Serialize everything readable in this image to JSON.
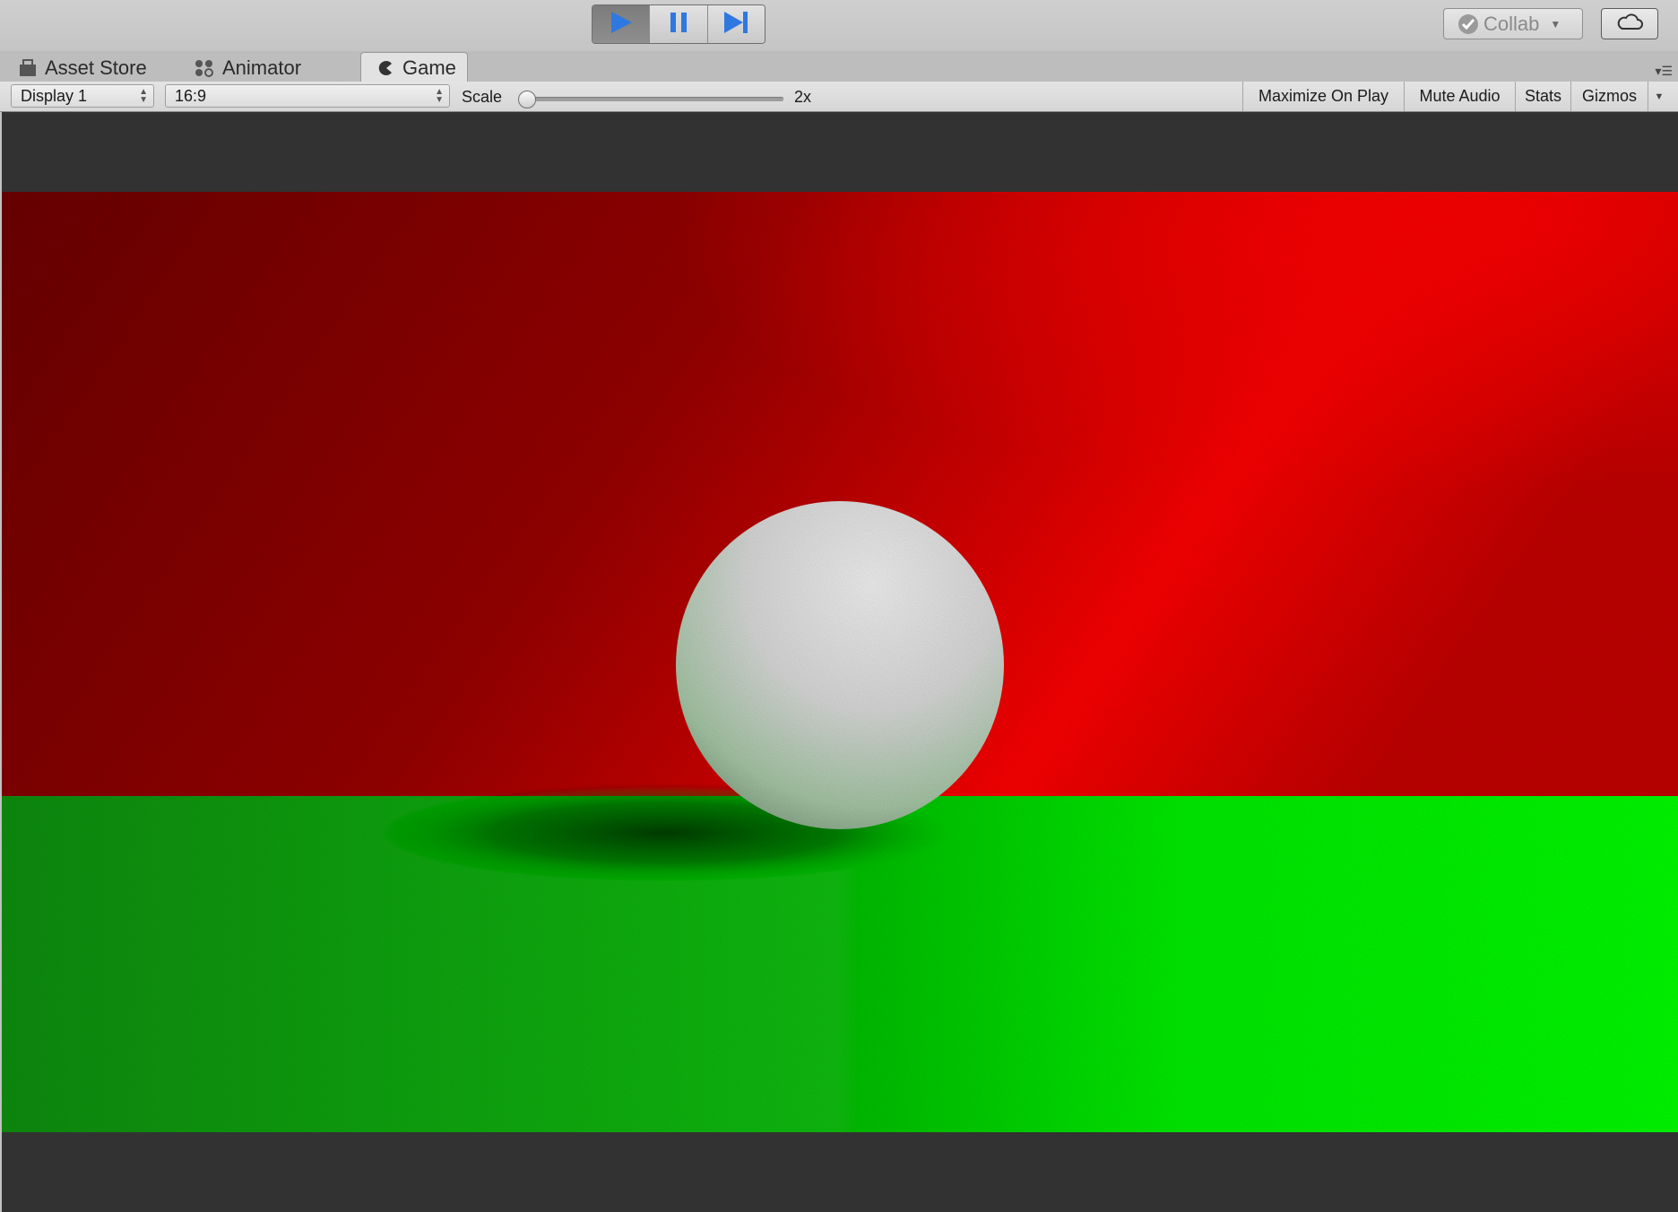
{
  "toolbar": {
    "play_state": "playing",
    "collab_label": "Collab"
  },
  "tabs": [
    {
      "label": "Asset Store",
      "icon": "asset-store-icon",
      "active": false
    },
    {
      "label": "Animator",
      "icon": "animator-icon",
      "active": false
    },
    {
      "label": "Game",
      "icon": "game-controller-icon",
      "active": true
    }
  ],
  "game_toolbar": {
    "display_select": "Display 1",
    "aspect_select": "16:9",
    "scale_label": "Scale",
    "scale_value_text": "2x",
    "scale_slider_fraction": 0.0,
    "buttons": [
      "Maximize On Play",
      "Mute Audio",
      "Stats",
      "Gizmos"
    ]
  },
  "colors": {
    "wall_red": "#ff0000",
    "wall_red_dark": "#6a0000",
    "floor_green": "#00ff00",
    "floor_green_dark": "#0b7a0b",
    "sphere": "#e6e6e6",
    "viewport_bg": "#323232",
    "play_blue": "#2f78e0"
  }
}
